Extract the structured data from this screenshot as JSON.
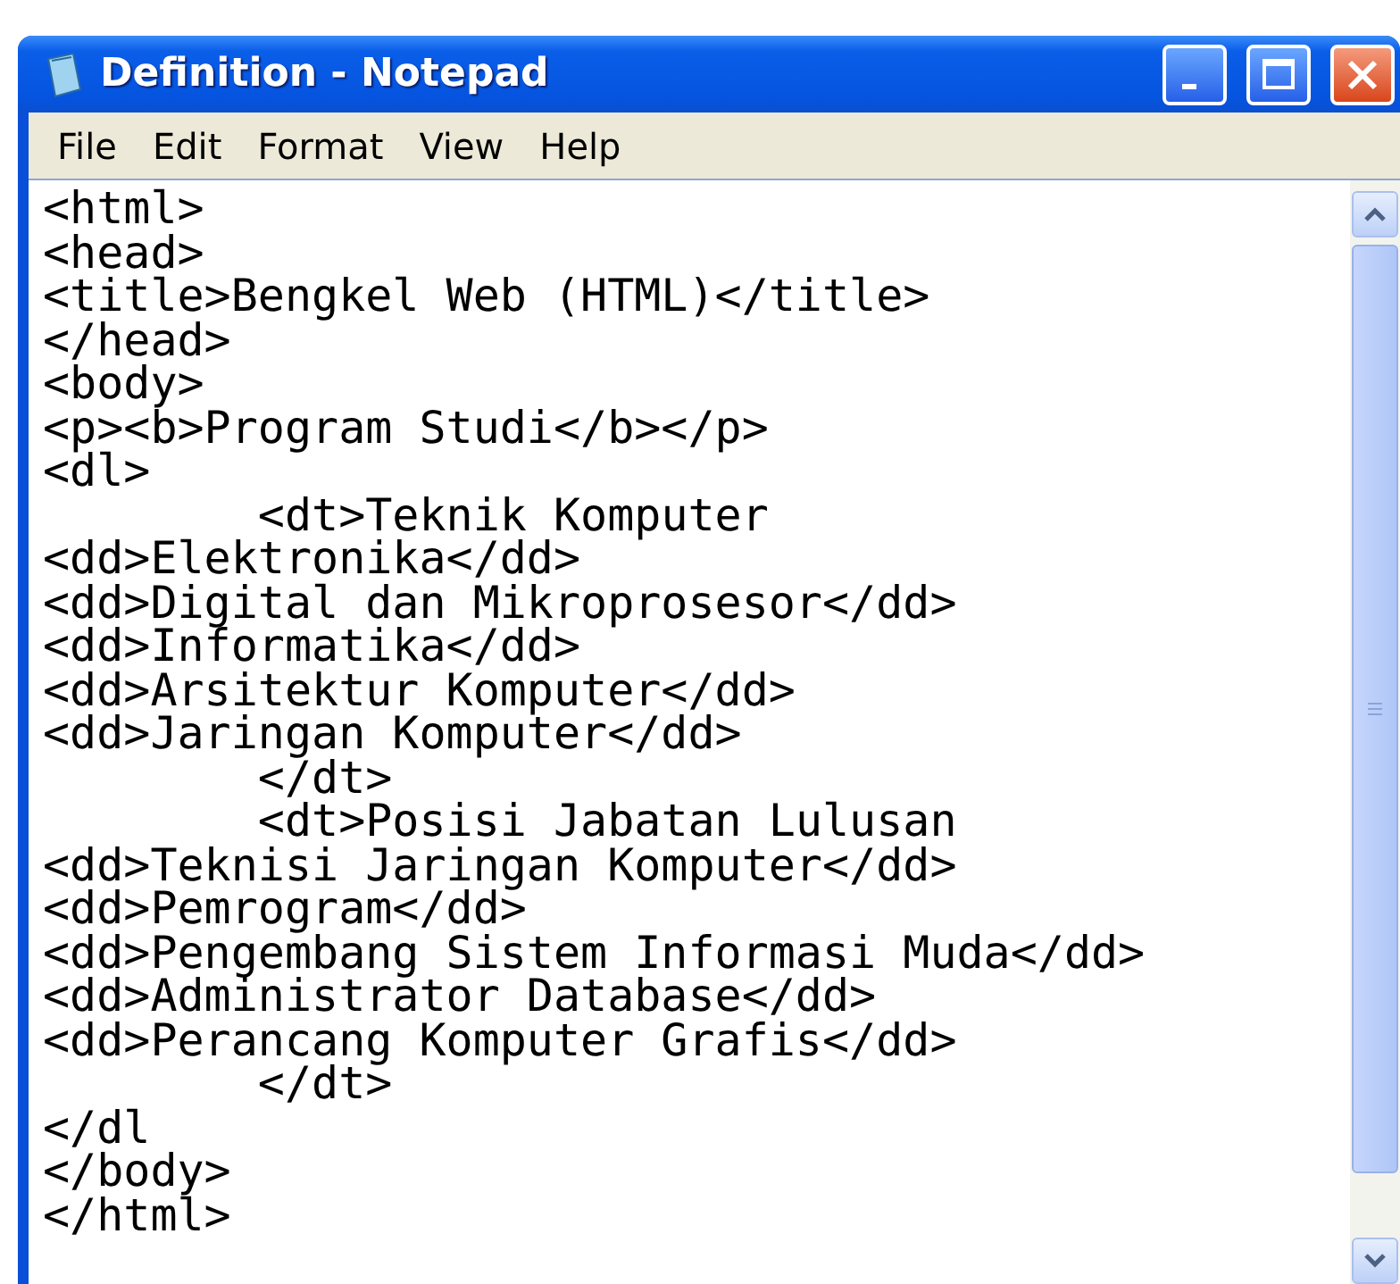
{
  "window": {
    "title": "Definition - Notepad"
  },
  "menu": [
    "File",
    "Edit",
    "Format",
    "View",
    "Help"
  ],
  "editor": {
    "lines": [
      "<html>",
      "<head>",
      "<title>Bengkel Web (HTML)</title>",
      "</head>",
      "<body>",
      "<p><b>Program Studi</b></p>",
      "<dl>",
      "\t<dt>Teknik Komputer",
      "<dd>Elektronika</dd>",
      "<dd>Digital dan Mikroprosesor</dd>",
      "<dd>Informatika</dd>",
      "<dd>Arsitektur Komputer</dd>",
      "<dd>Jaringan Komputer</dd>",
      "\t</dt>",
      "\t<dt>Posisi Jabatan Lulusan",
      "<dd>Teknisi Jaringan Komputer</dd>",
      "<dd>Pemrogram</dd>",
      "<dd>Pengembang Sistem Informasi Muda</dd>",
      "<dd>Administrator Database</dd>",
      "<dd>Perancang Komputer Grafis</dd>",
      "\t</dt>",
      "</dl",
      "</body>",
      "</html>"
    ]
  }
}
